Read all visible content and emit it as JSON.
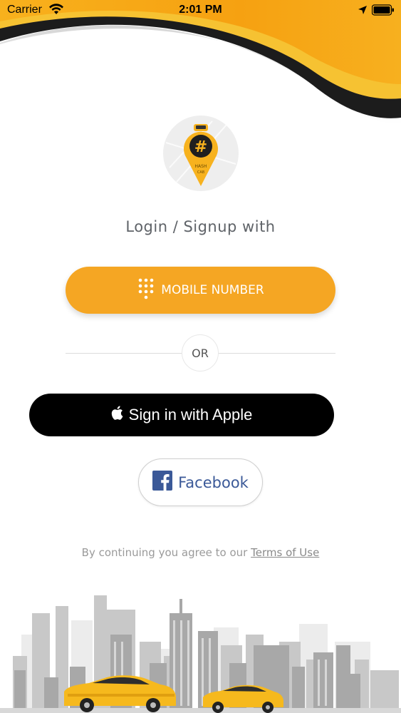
{
  "status_bar": {
    "carrier": "Carrier",
    "time": "2:01 PM",
    "icons": [
      "wifi-icon",
      "location-arrow-icon",
      "battery-icon"
    ]
  },
  "logo": {
    "text_main": "#",
    "text_sub_1": "HASH",
    "text_sub_2": "CAB"
  },
  "main": {
    "title": "Login / Signup with",
    "mobile_button_label": "MOBILE NUMBER",
    "or_label": "OR",
    "apple_button_label": "Sign in with Apple",
    "facebook_button_label": "Facebook"
  },
  "footer": {
    "terms_prefix": "By continuing you agree to our ",
    "terms_link": "Terms of Use"
  },
  "colors": {
    "accent": "#f5a623",
    "wave_dark": "#1c1c1c",
    "facebook": "#3b5998",
    "apple_bg": "#000000"
  }
}
